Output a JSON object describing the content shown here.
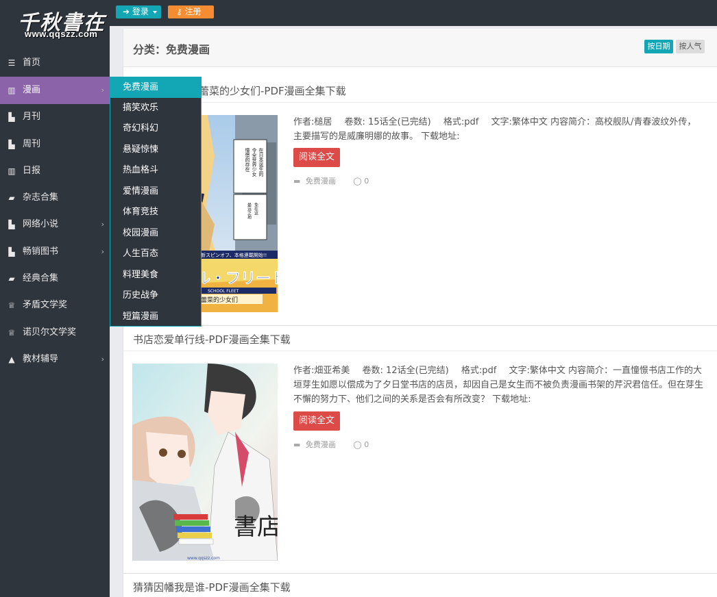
{
  "logo": {
    "main": "千秋書在",
    "sub": "www.qqszz.com"
  },
  "header": {
    "login_label": "登录",
    "register_label": "注册"
  },
  "sidebar": {
    "items": [
      {
        "label": "首页",
        "icon": "list-icon"
      },
      {
        "label": "漫画",
        "icon": "map-icon"
      },
      {
        "label": "月刊",
        "icon": "book-open-icon"
      },
      {
        "label": "周刊",
        "icon": "book-open-icon"
      },
      {
        "label": "日报",
        "icon": "map-icon"
      },
      {
        "label": "杂志合集",
        "icon": "book-icon"
      },
      {
        "label": "网络小说",
        "icon": "book-open-icon"
      },
      {
        "label": "畅销图书",
        "icon": "book-open-icon"
      },
      {
        "label": "经典合集",
        "icon": "book-icon"
      },
      {
        "label": "矛盾文学奖",
        "icon": "trophy-icon"
      },
      {
        "label": "诺贝尔文学奖",
        "icon": "trophy-icon"
      },
      {
        "label": "教材辅导",
        "icon": "graduation-cap-icon"
      }
    ]
  },
  "submenu": {
    "items": [
      "免费漫画",
      "搞笑欢乐",
      "奇幻科幻",
      "悬疑惊悚",
      "热血格斗",
      "爱情漫画",
      "体育竞技",
      "校园漫画",
      "人生百态",
      "料理美食",
      "历史战争",
      "短篇漫画"
    ]
  },
  "content": {
    "page_title": "分类：免费漫画",
    "sort_date": "按日期",
    "sort_popular": "按人气"
  },
  "articles": [
    {
      "title": "蕾菜的少女们-PDF漫画全集下载",
      "author": "作者:槌居",
      "volumes": "卷数: 15话全(已完结)",
      "format": "格式:pdf",
      "desc": "文字:繁体中文 内容简介：高校舰队/青春波纹外传，主要描写的是威廉明娜的故事。 下载地址:",
      "read_label": "阅读全文",
      "category": "免费漫画",
      "comments": "0",
      "cover_text": {
        "vertical_1": "在日本诞生的",
        "vertical_2": "令全世界少女",
        "vertical_3": "憧憬的存在",
        "vertical_4": "免在这",
        "vertical_5": "最远之地",
        "banner": "新スピンオフ、本格連載開始!!",
        "logo_a": "ール・フリート",
        "logo_b": "SCHOOL FLEET",
        "logo_c": "蕾菜的少女们"
      }
    },
    {
      "title": "书店恋爱单行线-PDF漫画全集下载",
      "author": "作者:畑亚希美",
      "volumes": "卷数: 12话全(已完结)",
      "format": "格式:pdf",
      "desc": "文字:繁体中文 内容简介：一直憧憬书店工作的大垣芽生如愿以偿成为了夕日堂书店的店员，却因自己是女生而不被负责漫画书架的芹沢君信任。但在芽生不懈的努力下、他们之间的关系是否会有所改变？ 下载地址:",
      "read_label": "阅读全文",
      "category": "免费漫画",
      "comments": "0",
      "cover_text": {
        "kanji": "書店",
        "url": "www.qqszz.com"
      }
    },
    {
      "title": "猜猜因幡我是谁-PDF漫画全集下载"
    }
  ],
  "colors": {
    "teal": "#13a6b5",
    "purple": "#8a63a9",
    "orange": "#f48c32",
    "red": "#dc4b47",
    "dark": "#2f353d"
  }
}
